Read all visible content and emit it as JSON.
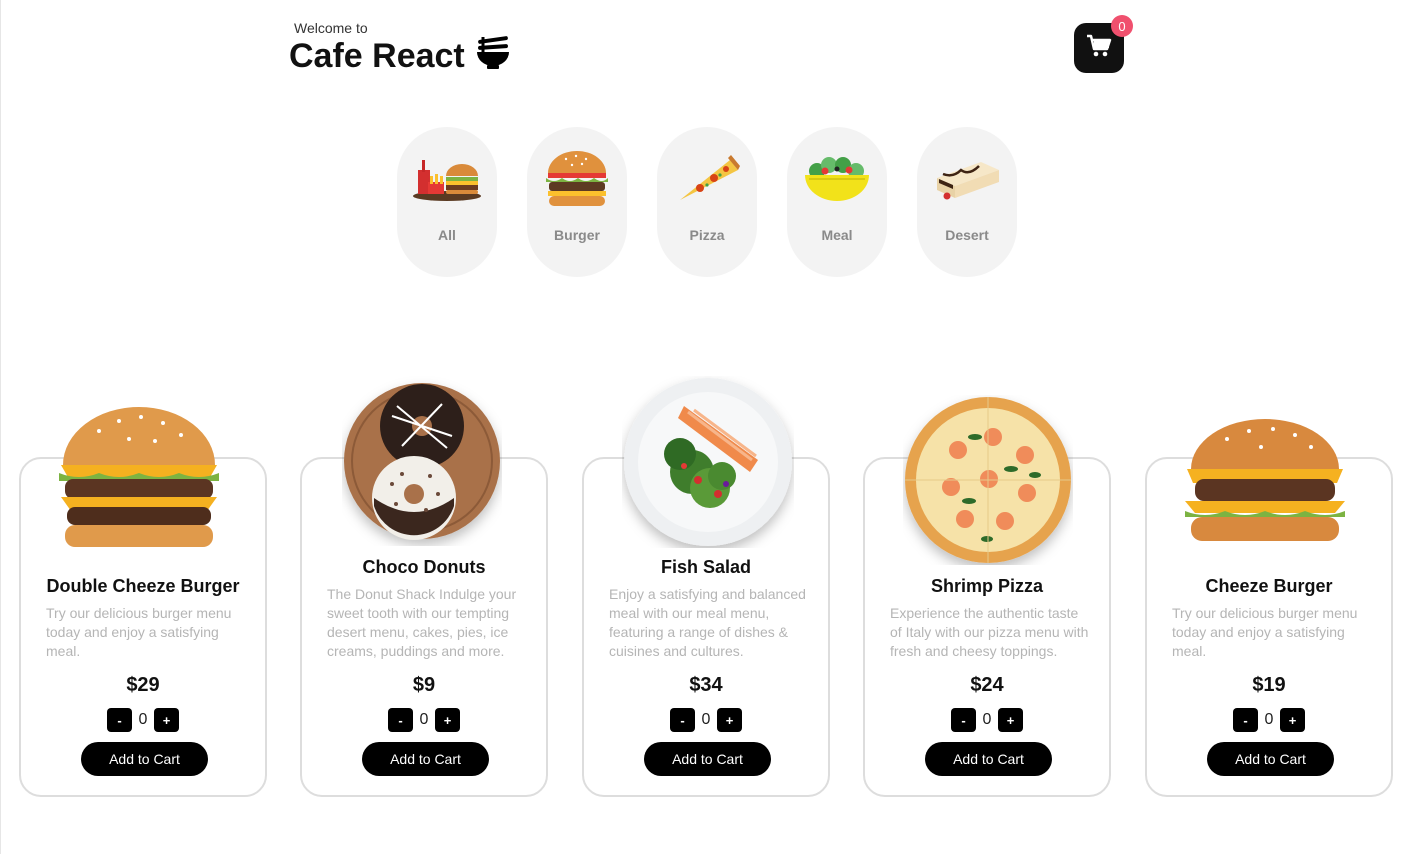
{
  "header": {
    "welcome": "Welcome to",
    "brand": "Cafe React"
  },
  "cart": {
    "count": "0"
  },
  "categories": [
    {
      "label": "All",
      "icon": "combo-meal-icon"
    },
    {
      "label": "Burger",
      "icon": "burger-icon"
    },
    {
      "label": "Pizza",
      "icon": "pizza-slice-icon"
    },
    {
      "label": "Meal",
      "icon": "salad-bowl-icon"
    },
    {
      "label": "Desert",
      "icon": "cake-slice-icon"
    }
  ],
  "products": [
    {
      "title": "Double Cheeze Burger",
      "desc": "Try our delicious burger menu today and enjoy a satisfying meal.",
      "price": "$29",
      "qty": "0",
      "minus": "-",
      "plus": "+",
      "add_label": "Add to Cart",
      "image": "burger-photo"
    },
    {
      "title": "Choco Donuts",
      "desc": "The Donut Shack Indulge your sweet tooth with our tempting desert menu, cakes, pies, ice creams, puddings and more.",
      "price": "$9",
      "qty": "0",
      "minus": "-",
      "plus": "+",
      "add_label": "Add to Cart",
      "image": "donuts-photo"
    },
    {
      "title": "Fish Salad",
      "desc": "Enjoy a satisfying and balanced meal with our meal menu, featuring a range of dishes & cuisines and cultures.",
      "price": "$34",
      "qty": "0",
      "minus": "-",
      "plus": "+",
      "add_label": "Add to Cart",
      "image": "salad-photo"
    },
    {
      "title": "Shrimp Pizza",
      "desc": "Experience the authentic taste of Italy with our pizza menu with fresh and cheesy toppings.",
      "price": "$24",
      "qty": "0",
      "minus": "-",
      "plus": "+",
      "add_label": "Add to Cart",
      "image": "pizza-photo"
    },
    {
      "title": "Cheeze Burger",
      "desc": "Try our delicious burger menu today and enjoy a satisfying meal.",
      "price": "$19",
      "qty": "0",
      "minus": "-",
      "plus": "+",
      "add_label": "Add to Cart",
      "image": "burger-photo"
    }
  ],
  "colors": {
    "accent": "#000000",
    "badge": "#f0506e",
    "muted_text": "#b5b5b5",
    "category_bg": "#f3f3f3"
  }
}
